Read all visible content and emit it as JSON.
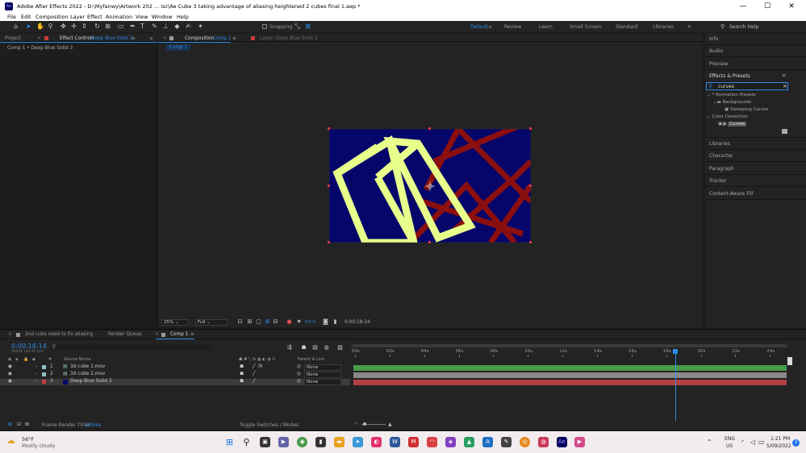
{
  "window": {
    "app_icon": "Ae",
    "title": "Adobe After Effects 2022 - D:\\Myfanwy\\Artwork 202 ... isc\\Ae Cube 3 taking advantage of aliasing heightened 2 cubes final 1.aep *",
    "minimize": "—",
    "maximize": "☐",
    "close": "✕"
  },
  "menu": [
    "File",
    "Edit",
    "Composition",
    "Layer",
    "Effect",
    "Animation",
    "View",
    "Window",
    "Help"
  ],
  "toolbar": {
    "snapping_label": "Snapping",
    "workspaces": [
      "Default",
      "Review",
      "Learn",
      "Small Screen",
      "Standard",
      "Libraries"
    ],
    "active_workspace": "Default",
    "overflow": "»",
    "search_help_placeholder": "Search Help"
  },
  "left_panel": {
    "tab_project": "Project",
    "tab_effect_controls": "Effect Controls",
    "tab_effect_controls_layer": "Deep Blue Solid 3",
    "menu_glyph": "≡",
    "overflow": "»",
    "subtitle": "Comp 1 • Deep Blue Solid 3"
  },
  "comp_panel": {
    "tab_comp_prefix": "Composition",
    "tab_comp_name": "Comp 1",
    "tab_layer": "Layer: Deep Blue Solid 3",
    "breadcrumb": "Comp 1",
    "menu_glyph": "≡",
    "zoom": "25%",
    "resolution": "Full",
    "exposure": "+0.0",
    "timecode": "0:00:18:14"
  },
  "right_panel": {
    "info": "Info",
    "audio": "Audio",
    "preview": "Preview",
    "effects_presets": "Effects & Presets",
    "search_value": "curves",
    "tree": {
      "animation_presets": "* Animation Presets",
      "backgrounds": "Backgrounds",
      "sweeping_curves": "Sweeping Curves",
      "color_correction": "Color Correction",
      "curves": "Curves"
    },
    "libraries": "Libraries",
    "character": "Character",
    "paragraph": "Paragraph",
    "tracker": "Tracker",
    "content_aware_fill": "Content-Aware Fill"
  },
  "timeline": {
    "tabs": [
      "2nd cube need to fix aliasing",
      "Render Queue",
      "Comp 1"
    ],
    "active_tab": "Comp 1",
    "timecode": "0:00:18:14",
    "frame_info": "00446 (24.00 fps)",
    "search_placeholder": "",
    "col_hash": "#",
    "col_source": "Source Name",
    "col_parent": "Parent & Link",
    "layers": [
      {
        "num": "1",
        "name": "3d cube 1.mov",
        "parent": "None",
        "color": "#8fbfbf",
        "bar": "#4a9a4a"
      },
      {
        "num": "2",
        "name": "3d cube 2.mov",
        "parent": "None",
        "color": "#8fbfbf",
        "bar": "#8a8a8a"
      },
      {
        "num": "3",
        "name": "Deep Blue Solid 3",
        "parent": "None",
        "color": "#c83c3c",
        "bar": "#b34040"
      }
    ],
    "ruler": [
      "00s",
      "02s",
      "04s",
      "06s",
      "08s",
      "10s",
      "12s",
      "14s",
      "16s",
      "18s",
      "20s",
      "22s",
      "24s"
    ],
    "playhead_fraction": 0.742,
    "footer_label": "Frame Render Time:",
    "footer_value": "285ms",
    "toggle_label": "Toggle Switches / Modes"
  },
  "taskbar": {
    "weather_temp": "56°F",
    "weather_desc": "Mostly cloudy",
    "lang": "ENG",
    "region": "US",
    "time": "1:21 PM",
    "date": "5/09/2022",
    "notif_count": "2"
  },
  "colors": {
    "accent": "#2d8ceb",
    "comp_bg": "#06066a",
    "yellow_cube": "#e8ff8c",
    "red_cube": "#8b0f0f"
  }
}
